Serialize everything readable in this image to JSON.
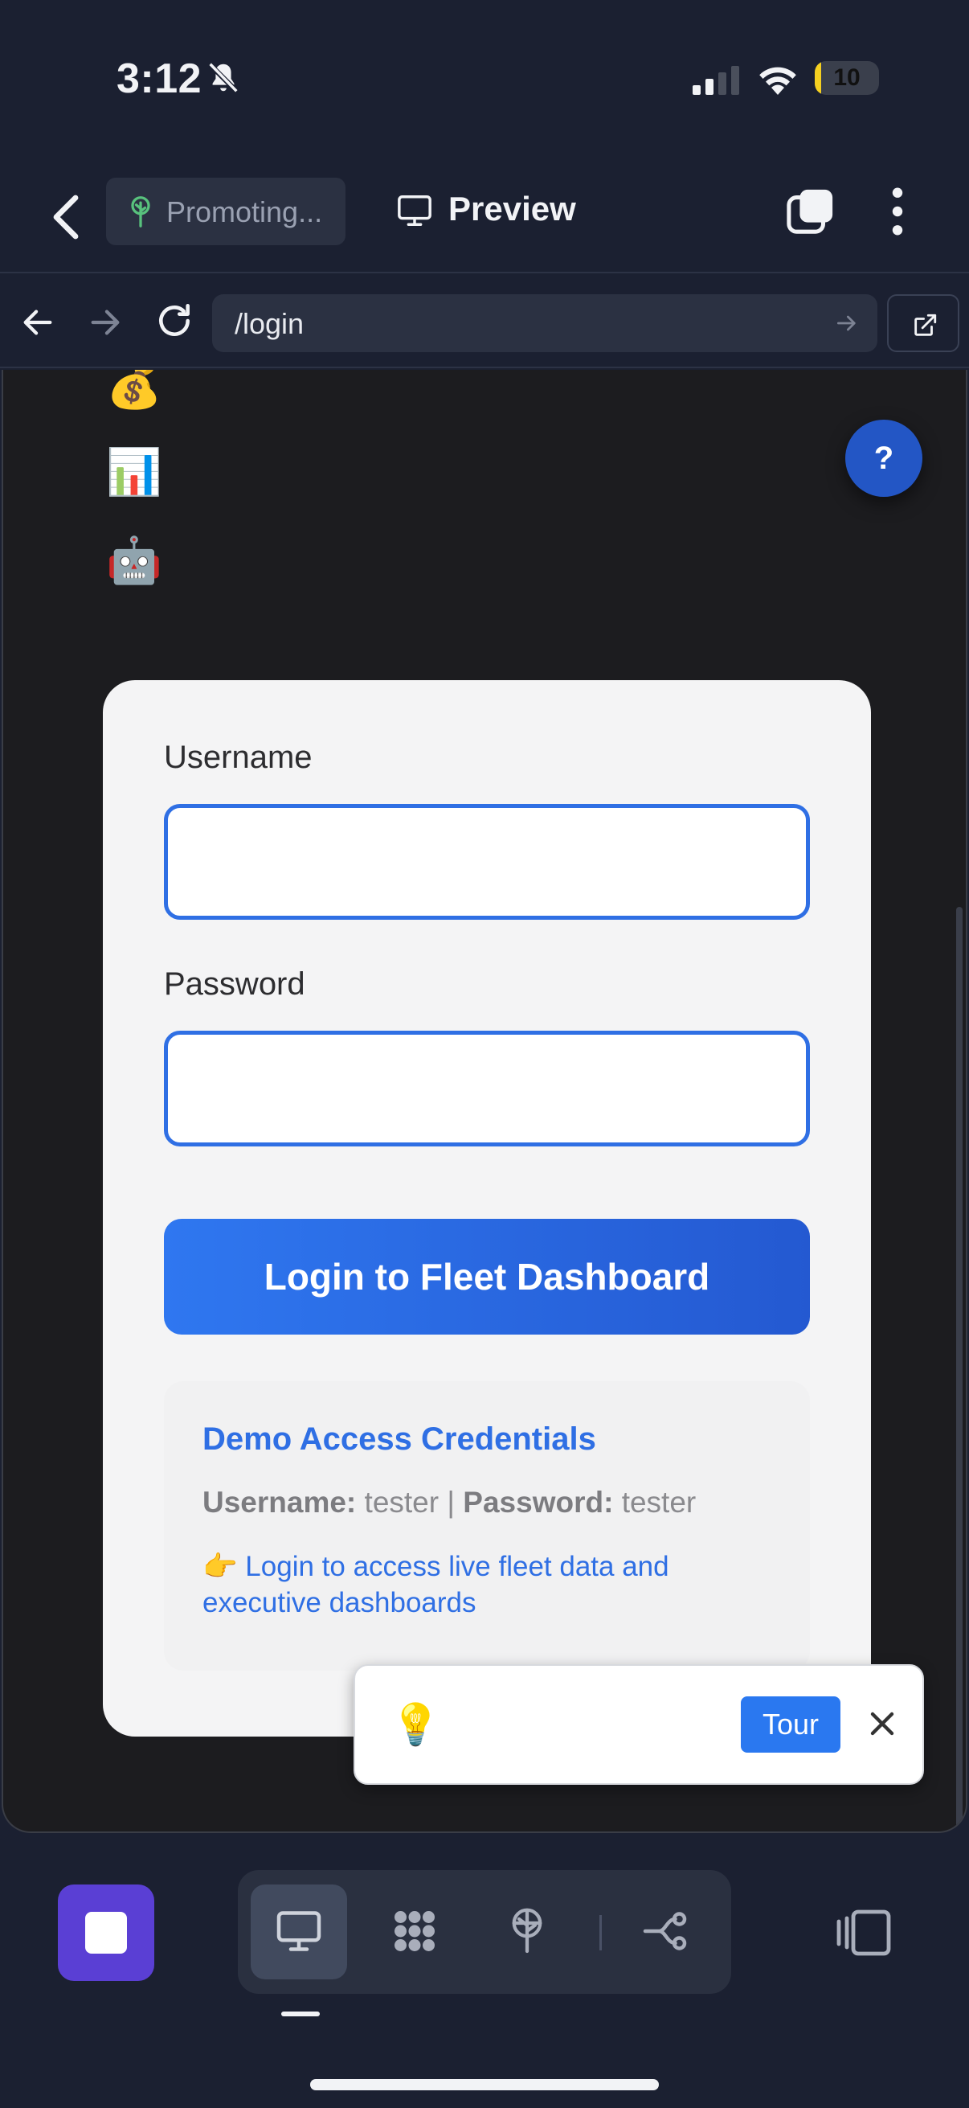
{
  "status_bar": {
    "time": "3:12",
    "battery_level": "10",
    "battery_fraction": 0.1
  },
  "header": {
    "branch_label": "Promoting...",
    "title": "Preview"
  },
  "url_bar": {
    "url": "/login"
  },
  "page": {
    "emoji_items": [
      "💰",
      "📊",
      "🤖"
    ],
    "help_label": "?",
    "login": {
      "username_label": "Username",
      "username_value": "",
      "password_label": "Password",
      "password_value": "",
      "submit_label": "Login to Fleet Dashboard",
      "demo": {
        "title": "Demo Access Credentials",
        "username_label": "Username:",
        "username_value": "tester",
        "separator": "|",
        "password_label": "Password:",
        "password_value": "tester",
        "note": "👉 Login to access live fleet data and executive dashboards"
      }
    },
    "tour_popup": {
      "icon": "💡",
      "button_label": "Tour",
      "close_label": "×"
    }
  },
  "toolbar": {
    "modes": [
      "preview-mode-icon",
      "grid-mode-icon",
      "deploy-mode-icon",
      "branch-mode-icon"
    ],
    "active_mode": "preview-mode-icon"
  },
  "colors": {
    "accent": "#2f6fe4",
    "stop_button": "#5a3fd4",
    "background": "#1b2031"
  }
}
